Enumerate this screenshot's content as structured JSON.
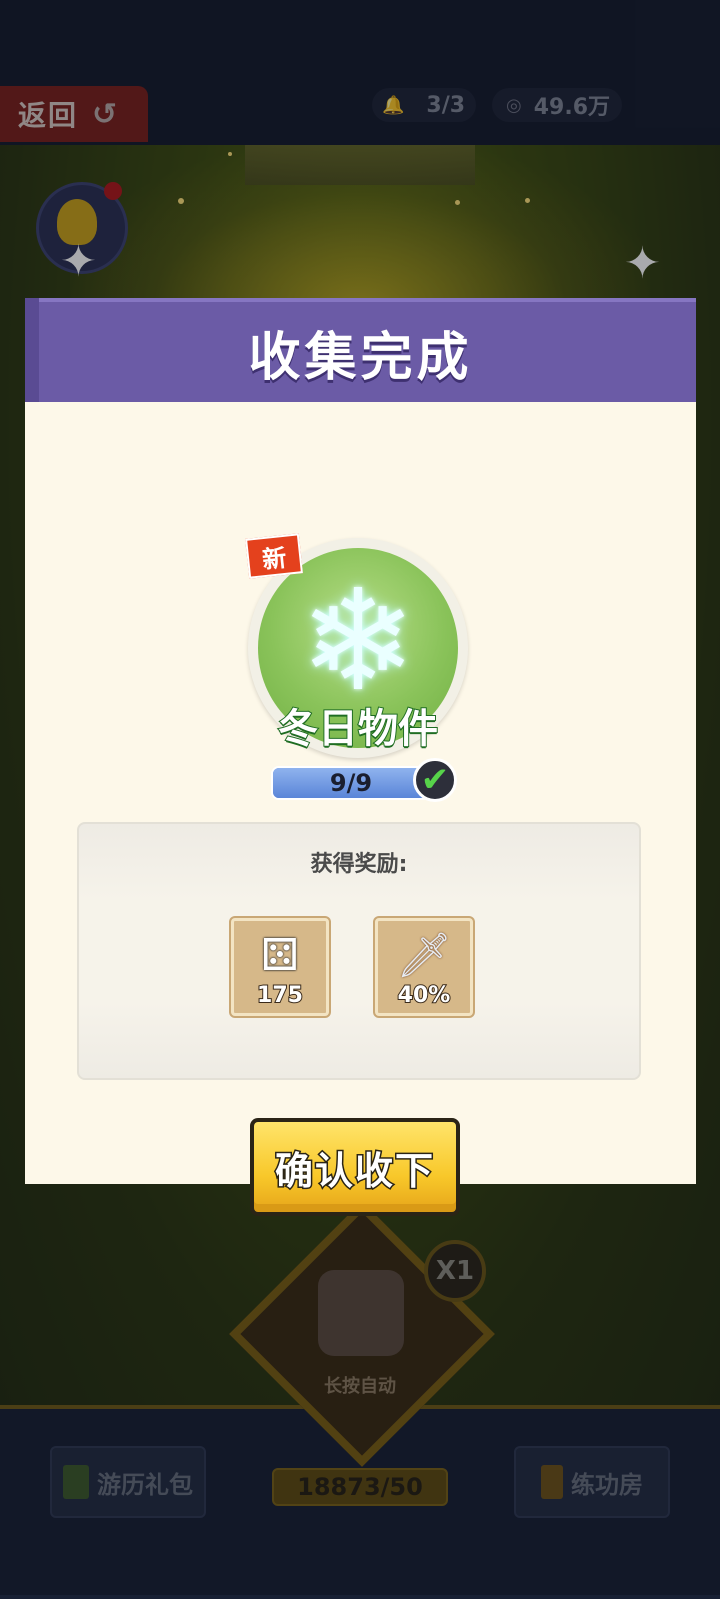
{
  "topbar": {
    "back_label": "返回",
    "back_icon": "undo-arrow-icon",
    "bell_icon": "bell-icon",
    "bell_count": "3/3",
    "coin_icon": "coin-icon",
    "coin_amount": "49.6万"
  },
  "scene": {
    "avatar_icon": "character-avatar-icon",
    "dice_icon": "dice-icon",
    "long_press_label": "长按自动",
    "multiplier": "X1",
    "left_button_label": "游历礼包",
    "right_button_label": "练功房",
    "step_counter": "18873/50"
  },
  "modal": {
    "title": "收集完成",
    "new_tag": "新",
    "badge_icon": "snowflake-icon",
    "badge_name": "冬日物件",
    "progress_text": "9/9",
    "progress_fraction": 1.0,
    "progress_check_icon": "checkmark-icon",
    "reward_title": "获得奖励:",
    "rewards": [
      {
        "icon": "dice-icon",
        "value": "175"
      },
      {
        "icon": "sword-icon",
        "value": "40%"
      }
    ],
    "confirm_label": "确认收下"
  },
  "colors": {
    "header_purple": "#6b5ba6",
    "body_cream": "#fdf8e9",
    "confirm_yellow": "#f8c82a",
    "badge_green": "#8ac35a",
    "new_tag_red": "#e4411d"
  }
}
